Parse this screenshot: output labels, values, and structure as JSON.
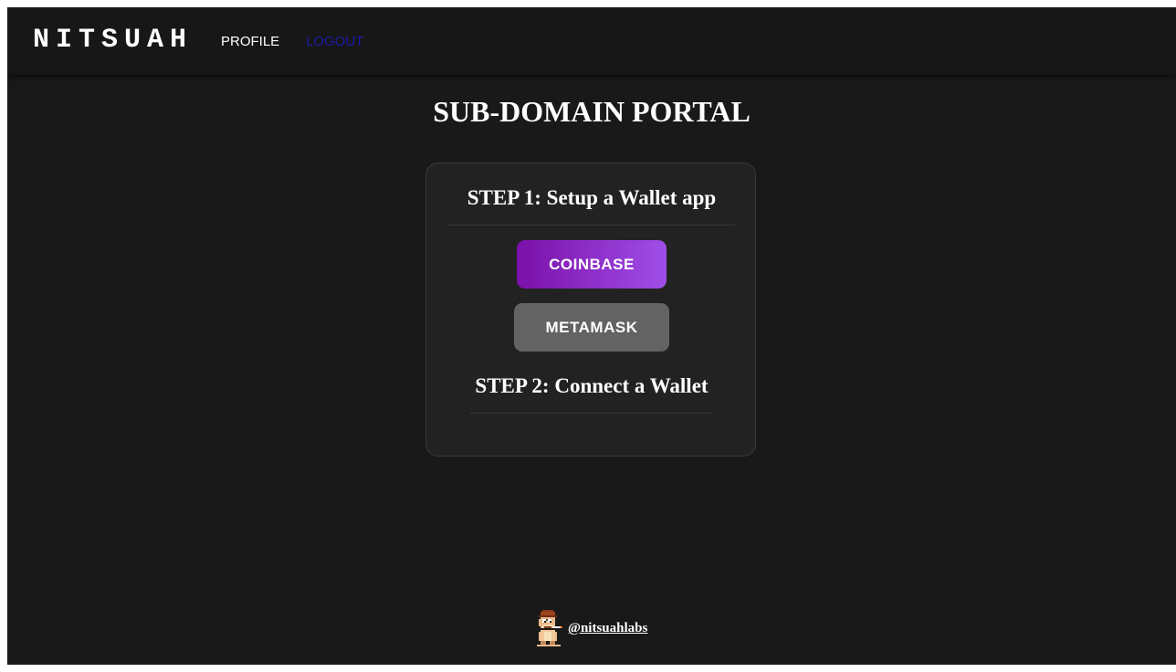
{
  "navbar": {
    "brand": "NITSUAH",
    "links": {
      "profile": "PROFILE",
      "logout": "LOGOUT"
    },
    "logout_color": "#1a1aa8"
  },
  "main": {
    "title": "SUB-DOMAIN PORTAL",
    "card": {
      "step1_heading": "STEP 1: Setup a Wallet app",
      "buttons": {
        "coinbase": "COINBASE",
        "metamask": "METAMASK"
      },
      "step2_heading": "STEP 2: Connect a Wallet"
    }
  },
  "footer": {
    "handle": "@nitsuahlabs",
    "avatar_icon": "pixel-ape-avatar-icon"
  },
  "colors": {
    "background": "#191919",
    "navbar": "#171717",
    "card": "#222222",
    "coinbase_gradient_start": "#7a10a8",
    "coinbase_gradient_end": "#a04ee8",
    "metamask": "#636363"
  }
}
